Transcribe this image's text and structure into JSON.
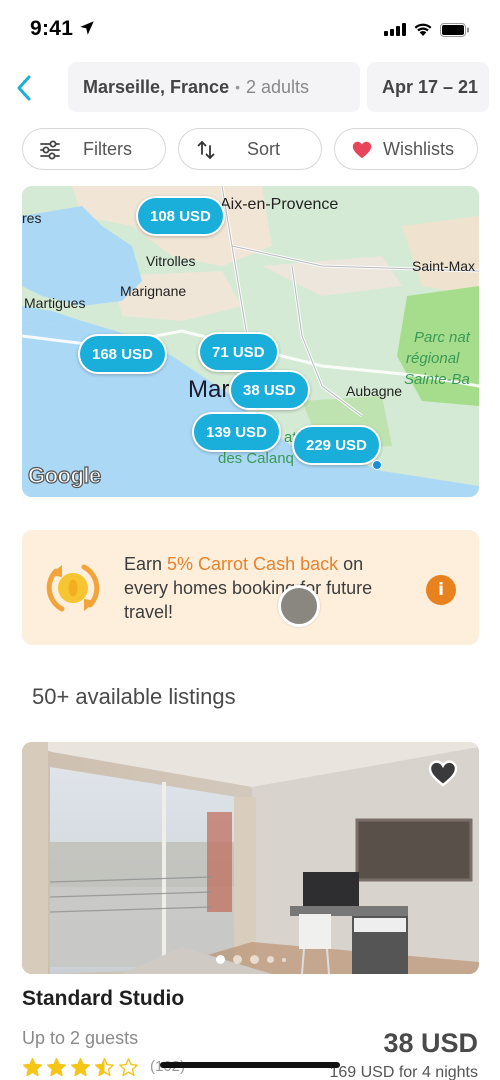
{
  "status_bar": {
    "time": "9:41",
    "icons": [
      "location-arrow-icon",
      "cellular-signal-icon",
      "wifi-icon",
      "battery-icon"
    ]
  },
  "header": {
    "back_icon": "chevron-left-icon",
    "destination": "Marseille, France",
    "separator": "•",
    "guests": "2 adults",
    "dates": "Apr 17 – 21"
  },
  "chips": [
    {
      "label": "Filters",
      "icon": "sliders-icon"
    },
    {
      "label": "Sort",
      "icon": "sort-arrows-icon"
    },
    {
      "label": "Wishlists",
      "icon": "heart-icon"
    }
  ],
  "map": {
    "labels": {
      "aix": "Aix-en-Provence",
      "istres": "res",
      "vitrolles": "Vitrolles",
      "marignane": "Marignane",
      "martigues": "Martigues",
      "saint_max": "Saint-Max",
      "marseille": "Mar",
      "aubagne": "Aubagne",
      "park_line1": "Parc nat",
      "park_line2": "régional",
      "park_line3": "Sainte-Ba",
      "calanques_1": "ati",
      "calanques_2": "des Calanq"
    },
    "price_pins": [
      {
        "label": "108 USD"
      },
      {
        "label": "168 USD"
      },
      {
        "label": "71 USD"
      },
      {
        "label": "38 USD"
      },
      {
        "label": "139 USD"
      },
      {
        "label": "229 USD"
      }
    ],
    "attribution": "Google"
  },
  "promo": {
    "icon": "coin-cashback-icon",
    "text_prefix": "Earn ",
    "text_highlight": "5% Carrot Cash back",
    "text_suffix": " on every homes booking for future travel!",
    "info_icon": "info-icon",
    "info_glyph": "i",
    "colors": {
      "background": "#fdefdc",
      "accent": "#e8822a"
    }
  },
  "listings": {
    "count_label": "50+ available listings",
    "items": [
      {
        "title": "Standard Studio",
        "guests": "Up to 2 guests",
        "rating": 3.5,
        "rating_max": 5,
        "review_count": "(102)",
        "price": "38 USD",
        "total_price": "169 USD for 4 nights",
        "photo_count": 5,
        "active_photo": 1,
        "favorite_icon": "heart-outline-icon"
      }
    ]
  },
  "colors": {
    "brand": "#1aaedb",
    "wishlist_heart": "#e8445a",
    "star": "#f5c518"
  }
}
